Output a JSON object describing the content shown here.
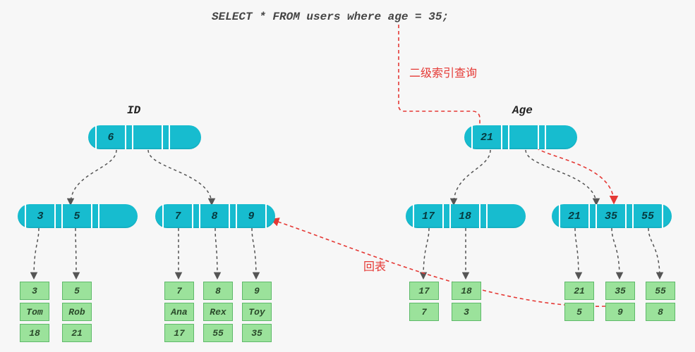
{
  "sql": "SELECT * FROM users where age = 35;",
  "labels": {
    "left_tree": "ID",
    "right_tree": "Age",
    "secondary_index": "二级索引查询",
    "back_to_table": "回表"
  },
  "left": {
    "root": [
      "6"
    ],
    "level2_a": [
      "3",
      "5"
    ],
    "level2_b": [
      "7",
      "8",
      "9"
    ],
    "leaves": [
      {
        "cells": [
          "3",
          "Tom",
          "18"
        ]
      },
      {
        "cells": [
          "5",
          "Rob",
          "21"
        ]
      },
      {
        "cells": [
          "7",
          "Ana",
          "17"
        ]
      },
      {
        "cells": [
          "8",
          "Rex",
          "55"
        ]
      },
      {
        "cells": [
          "9",
          "Toy",
          "35"
        ]
      }
    ]
  },
  "right": {
    "root": [
      "21"
    ],
    "level2_a": [
      "17",
      "18"
    ],
    "level2_b": [
      "21",
      "35",
      "55"
    ],
    "leaves": [
      {
        "cells": [
          "17",
          "7"
        ]
      },
      {
        "cells": [
          "18",
          "3"
        ]
      },
      {
        "cells": [
          "21",
          "5"
        ]
      },
      {
        "cells": [
          "35",
          "9"
        ]
      },
      {
        "cells": [
          "55",
          "8"
        ]
      }
    ]
  },
  "chart_data": {
    "type": "table",
    "description": "B+tree index diagram: primary key (ID) tree on left with user rows, secondary index (Age) tree on right mapping age→id. Red dashed paths show secondary-index lookup for age=35 then a back-to-table lookup into the ID tree.",
    "users": [
      {
        "id": 3,
        "name": "Tom",
        "age": 18
      },
      {
        "id": 5,
        "name": "Rob",
        "age": 21
      },
      {
        "id": 7,
        "name": "Ana",
        "age": 17
      },
      {
        "id": 8,
        "name": "Rex",
        "age": 55
      },
      {
        "id": 9,
        "name": "Toy",
        "age": 35
      }
    ],
    "secondary_index_age_to_id": [
      {
        "age": 17,
        "id": 7
      },
      {
        "age": 18,
        "id": 3
      },
      {
        "age": 21,
        "id": 5
      },
      {
        "age": 35,
        "id": 9
      },
      {
        "age": 55,
        "id": 8
      }
    ]
  }
}
